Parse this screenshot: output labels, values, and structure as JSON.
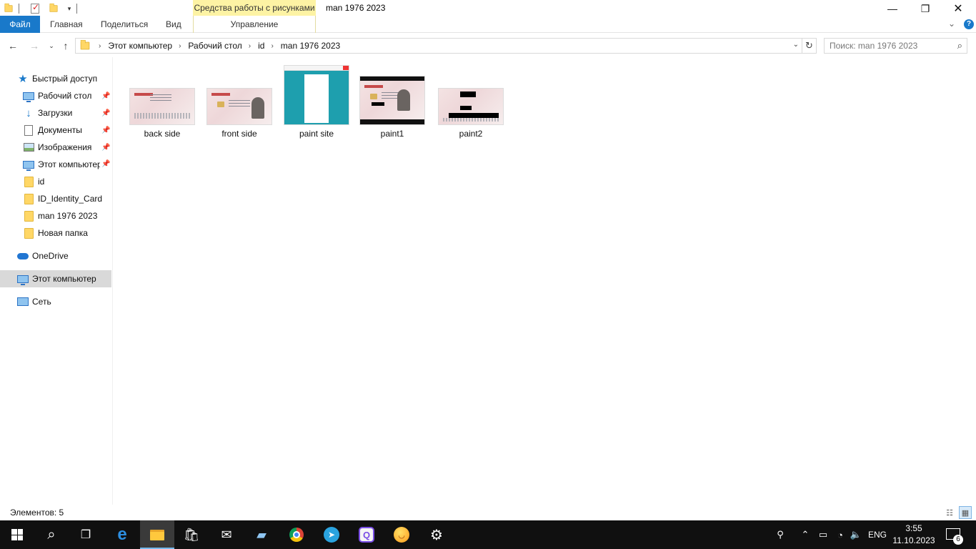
{
  "window": {
    "title": "man 1976 2023",
    "context_tab_group": "Средства работы с рисунками"
  },
  "ribbon": {
    "tabs": [
      {
        "label": "Файл"
      },
      {
        "label": "Главная"
      },
      {
        "label": "Поделиться"
      },
      {
        "label": "Вид"
      },
      {
        "label": "Управление"
      }
    ]
  },
  "address": {
    "breadcrumb": [
      "Этот компьютер",
      "Рабочий стол",
      "id",
      "man 1976 2023"
    ]
  },
  "search": {
    "placeholder": "Поиск: man 1976 2023"
  },
  "navpane": {
    "quick_access": "Быстрый доступ",
    "items": [
      {
        "label": "Рабочий стол",
        "icon": "desktop-icon",
        "pinned": true
      },
      {
        "label": "Загрузки",
        "icon": "downloads-icon",
        "pinned": true
      },
      {
        "label": "Документы",
        "icon": "documents-icon",
        "pinned": true
      },
      {
        "label": "Изображения",
        "icon": "pictures-icon",
        "pinned": true
      },
      {
        "label": "Этот компьютер",
        "icon": "computer-icon",
        "pinned": true
      },
      {
        "label": "id",
        "icon": "folder-icon",
        "pinned": false
      },
      {
        "label": "ID_Identity_Card",
        "icon": "folder-icon",
        "pinned": false
      },
      {
        "label": "man 1976 2023",
        "icon": "folder-icon",
        "pinned": false
      },
      {
        "label": "Новая папка",
        "icon": "folder-icon",
        "pinned": false
      }
    ],
    "onedrive": "OneDrive",
    "this_pc": "Этот компьютер",
    "network": "Сеть"
  },
  "files": [
    {
      "name": "back side"
    },
    {
      "name": "front side"
    },
    {
      "name": "paint site"
    },
    {
      "name": "paint1"
    },
    {
      "name": "paint2"
    }
  ],
  "status": {
    "count": "Элементов: 5"
  },
  "taskbar": {
    "language": "ENG",
    "time": "3:55",
    "date": "11.10.2023",
    "notifications": "6"
  },
  "colors": {
    "accent": "#1979ca",
    "context_tab": "#fdf3a4",
    "taskbar": "#101010",
    "selected_nav": "#d9d9d9"
  }
}
